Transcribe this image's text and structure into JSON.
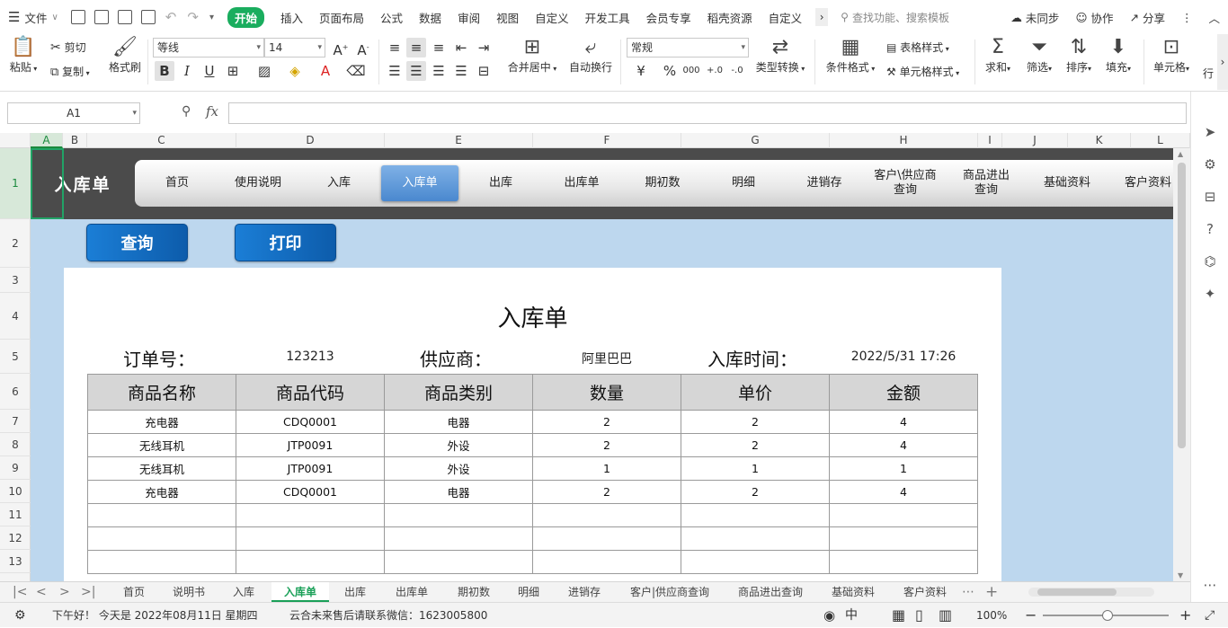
{
  "menubar": {
    "file": "文件",
    "tabs": [
      "开始",
      "插入",
      "页面布局",
      "公式",
      "数据",
      "审阅",
      "视图",
      "自定义",
      "开发工具",
      "会员专享",
      "稻壳资源",
      "自定义"
    ],
    "search_placeholder": "查找功能、搜索模板",
    "sync": "未同步",
    "collab": "协作",
    "share": "分享"
  },
  "ribbon": {
    "paste": "粘贴",
    "cut": "剪切",
    "copy": "复制",
    "format_painter": "格式刷",
    "font_name": "等线",
    "font_size": "14",
    "merge_center": "合并居中",
    "wrap_text": "自动换行",
    "number_format": "常规",
    "type_convert": "类型转换",
    "cond_format": "条件格式",
    "table_style": "表格样式",
    "cell_style": "单元格样式",
    "sum": "求和",
    "filter": "筛选",
    "sort": "排序",
    "fill": "填充",
    "cell": "单元格",
    "row_col": "行"
  },
  "formula": {
    "cell_ref": "A1",
    "fx": "fx",
    "value": ""
  },
  "columns": [
    "A",
    "B",
    "C",
    "D",
    "E",
    "F",
    "G",
    "H",
    "I",
    "J",
    "K",
    "L"
  ],
  "rows": [
    "1",
    "2",
    "3",
    "4",
    "5",
    "6",
    "7",
    "8",
    "9",
    "10",
    "11",
    "12",
    "13"
  ],
  "nav": {
    "title": "入库单",
    "items": [
      "首页",
      "使用说明",
      "入库",
      "入库单",
      "出库",
      "出库单",
      "期初数",
      "明细",
      "进销存",
      "客户\\供应商\n查询",
      "商品进出\n查询",
      "基础资料",
      "客户资料"
    ],
    "active_index": 3
  },
  "buttons": {
    "query": "查询",
    "print": "打印"
  },
  "document": {
    "title": "入库单",
    "order_label": "订单号：",
    "order_no": "123213",
    "supplier_label": "供应商：",
    "supplier": "阿里巴巴",
    "time_label": "入库时间：",
    "time": "2022/5/31 17:26",
    "headers": [
      "商品名称",
      "商品代码",
      "商品类别",
      "数量",
      "单价",
      "金额"
    ],
    "rows": [
      [
        "充电器",
        "CDQ0001",
        "电器",
        "2",
        "2",
        "4"
      ],
      [
        "无线耳机",
        "JTP0091",
        "外设",
        "2",
        "2",
        "4"
      ],
      [
        "无线耳机",
        "JTP0091",
        "外设",
        "1",
        "1",
        "1"
      ],
      [
        "充电器",
        "CDQ0001",
        "电器",
        "2",
        "2",
        "4"
      ],
      [
        "",
        "",
        "",
        "",
        "",
        ""
      ],
      [
        "",
        "",
        "",
        "",
        "",
        ""
      ],
      [
        "",
        "",
        "",
        "",
        "",
        ""
      ]
    ]
  },
  "sheet_tabs": {
    "items": [
      "首页",
      "说明书",
      "入库",
      "入库单",
      "出库",
      "出库单",
      "期初数",
      "明细",
      "进销存",
      "客户|供应商查询",
      "商品进出查询",
      "基础资料",
      "客户资料"
    ],
    "active_index": 3
  },
  "status": {
    "greeting": "下午好！ 今天是 2022年08月11日 星期四",
    "notice": "云合未来售后请联系微信：1623005800",
    "zoom": "100%"
  },
  "colors": {
    "accent": "#1aad5e",
    "nav_bg": "#4b4b4b",
    "sheet_bg": "#bdd7ee",
    "button_blue": "#1b7ed6",
    "header_gray": "#d6d6d6"
  }
}
